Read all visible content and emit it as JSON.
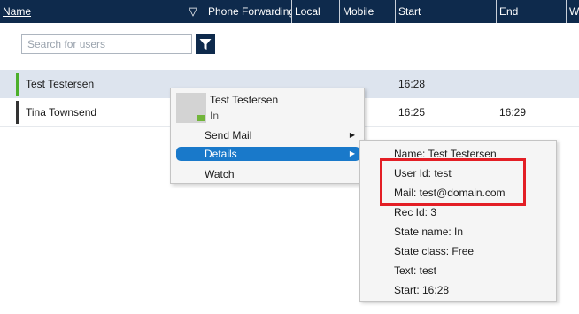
{
  "table": {
    "columns": [
      {
        "label": "Name",
        "sort": "▽"
      },
      {
        "label": "Phone Forwarding"
      },
      {
        "label": "Local"
      },
      {
        "label": "Mobile"
      },
      {
        "label": "Start"
      },
      {
        "label": "End"
      },
      {
        "label": "W"
      }
    ],
    "rows": [
      {
        "name": "Test Testersen",
        "start": "16:28",
        "end": "",
        "status_color": "#4caf2a"
      },
      {
        "name": "Tina Townsend",
        "start": "16:25",
        "end": "16:29",
        "status_color": "#333333"
      }
    ]
  },
  "search": {
    "placeholder": "Search for users",
    "value": ""
  },
  "context_menu": {
    "user_name": "Test Testersen",
    "user_state": "In",
    "items": [
      {
        "label": "Send Mail",
        "has_submenu": true
      },
      {
        "label": "Details",
        "has_submenu": true,
        "selected": true
      },
      {
        "label": "Watch",
        "has_submenu": false
      }
    ]
  },
  "details": [
    "Name: Test Testersen",
    "User Id: test",
    "Mail: test@domain.com",
    "Rec Id: 3",
    "State name: In",
    "State class: Free",
    "Text: test",
    "Start: 16:28"
  ],
  "colors": {
    "header_bg": "#0e2a4c",
    "selected_row": "#dde4ee",
    "menu_highlight": "#1979ca",
    "highlight_border": "#e31e25",
    "presence_free": "#71b53a"
  },
  "icons": [
    "sort-triangle-icon",
    "filter-icon",
    "submenu-arrow-icon"
  ]
}
